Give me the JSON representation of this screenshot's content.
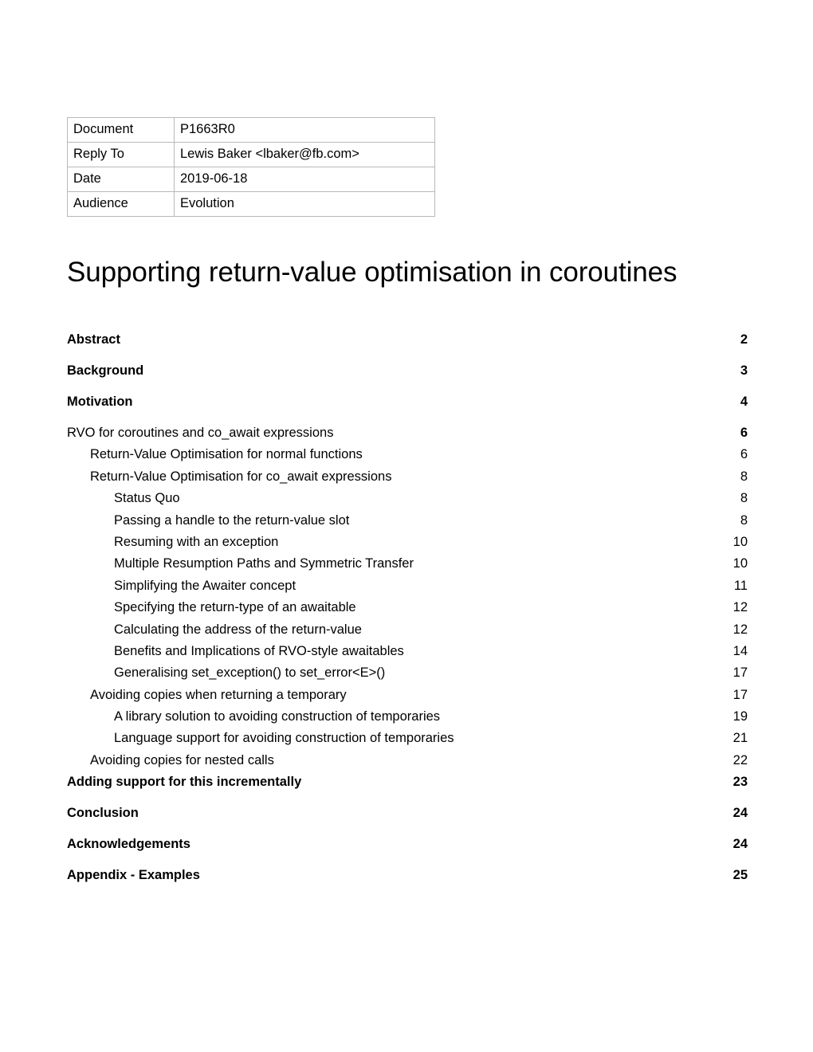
{
  "document": {
    "meta_table": {
      "rows": [
        {
          "key": "Document",
          "value": "P1663R0"
        },
        {
          "key": "Reply To",
          "value": "Lewis Baker <lbaker@fb.com>"
        },
        {
          "key": "Date",
          "value": "2019-06-18"
        },
        {
          "key": "Audience",
          "value": "Evolution"
        }
      ]
    },
    "title": "Supporting return-value optimisation in coroutines",
    "toc": {
      "entries": [
        {
          "label": "Abstract",
          "page": "2",
          "level": 1,
          "bold": true
        },
        {
          "label": "Background",
          "page": "3",
          "level": 1,
          "bold": true
        },
        {
          "label": "Motivation",
          "page": "4",
          "level": 1,
          "bold": true
        },
        {
          "label": "RVO for coroutines and co_await expressions",
          "page": "6",
          "level": 1,
          "bold": false,
          "bold_page": true
        },
        {
          "label": "Return-Value Optimisation for normal functions",
          "page": "6",
          "level": 2,
          "bold": false
        },
        {
          "label": "Return-Value Optimisation for co_await expressions",
          "page": "8",
          "level": 2,
          "bold": false
        },
        {
          "label": "Status Quo",
          "page": "8",
          "level": 3,
          "bold": false
        },
        {
          "label": "Passing a handle to the return-value slot",
          "page": "8",
          "level": 3,
          "bold": false
        },
        {
          "label": "Resuming with an exception",
          "page": "10",
          "level": 3,
          "bold": false
        },
        {
          "label": "Multiple Resumption Paths and Symmetric Transfer",
          "page": "10",
          "level": 3,
          "bold": false
        },
        {
          "label": "Simplifying the Awaiter concept",
          "page": "11",
          "level": 3,
          "bold": false
        },
        {
          "label": "Specifying the return-type of an awaitable",
          "page": "12",
          "level": 3,
          "bold": false
        },
        {
          "label": "Calculating the address of the return-value",
          "page": "12",
          "level": 3,
          "bold": false
        },
        {
          "label": "Benefits and Implications of RVO-style awaitables",
          "page": "14",
          "level": 3,
          "bold": false
        },
        {
          "label": "Generalising set_exception() to set_error<E>()",
          "page": "17",
          "level": 3,
          "bold": false
        },
        {
          "label": "Avoiding copies when returning a temporary",
          "page": "17",
          "level": 2,
          "bold": false
        },
        {
          "label": "A library solution to avoiding construction of temporaries",
          "page": "19",
          "level": 3,
          "bold": false
        },
        {
          "label": "Language support for avoiding construction of temporaries",
          "page": "21",
          "level": 3,
          "bold": false
        },
        {
          "label": "Avoiding copies for nested calls",
          "page": "22",
          "level": 2,
          "bold": false
        },
        {
          "label": "Adding support for this incrementally",
          "page": "23",
          "level": 1,
          "bold": true
        },
        {
          "label": "Conclusion",
          "page": "24",
          "level": 1,
          "bold": true
        },
        {
          "label": "Acknowledgements",
          "page": "24",
          "level": 1,
          "bold": true
        },
        {
          "label": "Appendix - Examples",
          "page": "25",
          "level": 1,
          "bold": true
        }
      ]
    }
  },
  "colors": {
    "page_background": "#ffffff",
    "text": "#000000",
    "table_border": "#b8b8b8"
  }
}
